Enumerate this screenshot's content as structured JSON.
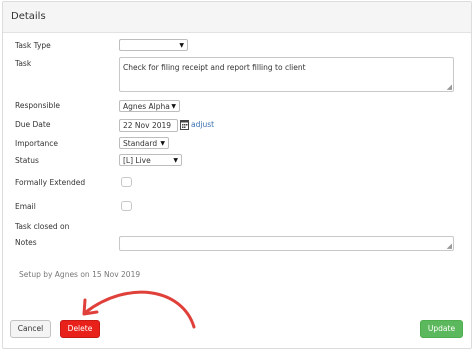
{
  "panel": {
    "title": "Details"
  },
  "fields": {
    "task_type": {
      "label": "Task Type",
      "value": ""
    },
    "task": {
      "label": "Task",
      "value": "Check for filing receipt and report filling to client"
    },
    "responsible": {
      "label": "Responsible",
      "value": "Agnes Alpha"
    },
    "due_date": {
      "label": "Due Date",
      "value": "22 Nov 2019",
      "adjust_link": "adjust"
    },
    "importance": {
      "label": "Importance",
      "value": "Standard"
    },
    "status": {
      "label": "Status",
      "value": "[L] Live"
    },
    "formally_extended": {
      "label": "Formally Extended",
      "checked": false
    },
    "email": {
      "label": "Email",
      "checked": false
    },
    "task_closed_on": {
      "label": "Task closed on"
    },
    "notes": {
      "label": "Notes",
      "value": ""
    }
  },
  "setup_text": "Setup by Agnes on 15 Nov 2019",
  "buttons": {
    "cancel": "Cancel",
    "delete": "Delete",
    "update": "Update"
  },
  "colors": {
    "delete": "#e8221b",
    "update": "#5cb85c",
    "annotation_arrow": "#e0403a",
    "link": "#3a6fb0"
  },
  "icons": {
    "calendar": "calendar-icon",
    "dropdown": "caret-down-icon",
    "arrow": "curved-arrow-icon"
  }
}
